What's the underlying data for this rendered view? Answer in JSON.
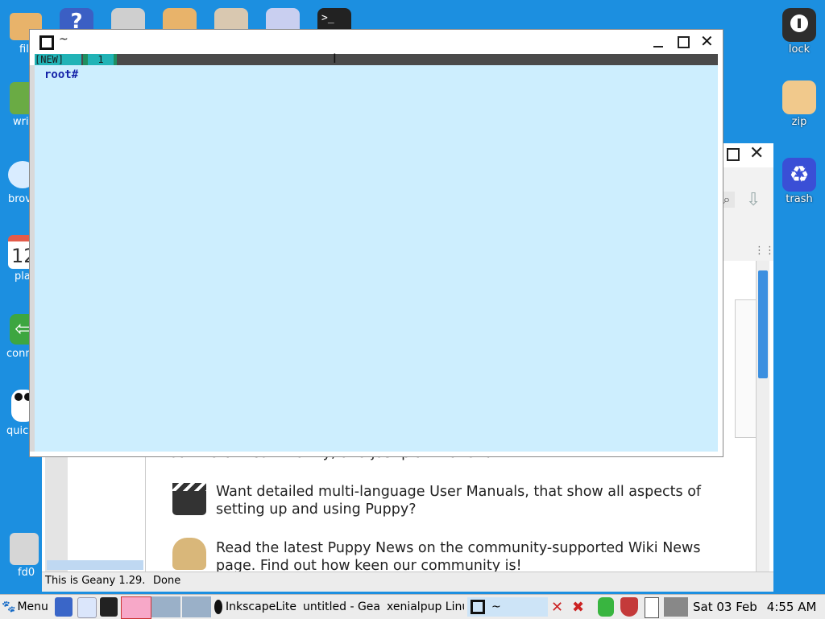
{
  "desktop": {
    "left_icons": [
      {
        "label": "file",
        "color": "#e0a040"
      },
      {
        "label": "write",
        "color": "#5a9e3a"
      },
      {
        "label": "browse",
        "color": "#cfe6fb"
      },
      {
        "label": "plan",
        "color": "#ffffff"
      },
      {
        "label": "connect",
        "color": "#3aa640"
      },
      {
        "label": "quickpet",
        "color": "#ffffff"
      },
      {
        "label": "fd0",
        "color": "#d8d8d8"
      }
    ],
    "right_icons": [
      {
        "label": "lock",
        "icon": "lock-icon"
      },
      {
        "label": "zip",
        "icon": "zip-icon"
      },
      {
        "label": "trash",
        "icon": "recycle-icon"
      }
    ],
    "partial_labels": [
      "file",
      "wri",
      "brov",
      "pla",
      "conn",
      "quick",
      "fd0"
    ],
    "calendar_digits": "12"
  },
  "terminal": {
    "title": "~",
    "tab_new": "[NEW]",
    "tab_num": "1",
    "prompt": "root#"
  },
  "browser": {
    "para1_tail": "our vibrant community, and just plain have fun.",
    "para2": "Want detailed multi-language User Manuals, that show all aspects of setting up and using Puppy?",
    "para3": "Read the latest Puppy News on the community-supported Wiki News page. Find out how keen our community is!",
    "status_left": "This is Geany 1.29.",
    "status_right": "Done",
    "side_letter": "e",
    "side_letter2": "t"
  },
  "taskbar": {
    "menu_label": "Menu",
    "tasks": [
      "InkscapeLite",
      "untitled - Geany",
      "xenialpup Linux",
      "~"
    ],
    "date": "Sat 03 Feb",
    "time": "4:55 AM"
  }
}
